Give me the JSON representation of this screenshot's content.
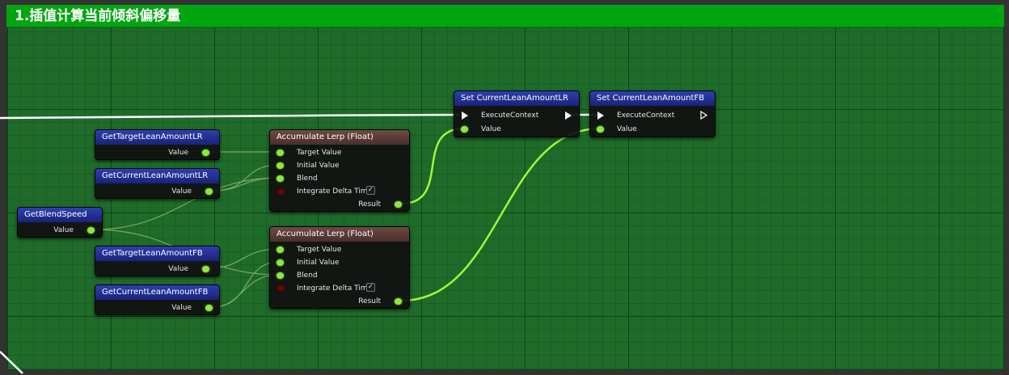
{
  "comment": {
    "title": "1.插值计算当前倾斜偏移量",
    "color": "#00a510"
  },
  "nodes": {
    "get_target_lr": {
      "title": "GetTargetLeanAmountLR",
      "out_label": "Value"
    },
    "get_current_lr": {
      "title": "GetCurrentLeanAmountLR",
      "out_label": "Value"
    },
    "get_blend_speed": {
      "title": "GetBlendSpeed",
      "out_label": "Value"
    },
    "get_target_fb": {
      "title": "GetTargetLeanAmountFB",
      "out_label": "Value"
    },
    "get_current_fb": {
      "title": "GetCurrentLeanAmountFB",
      "out_label": "Value"
    },
    "lerp_lr": {
      "title": "Accumulate Lerp (Float)",
      "inputs": [
        "Target Value",
        "Initial Value",
        "Blend",
        "Integrate Delta Time"
      ],
      "output": "Result",
      "integrate_checked": true
    },
    "lerp_fb": {
      "title": "Accumulate Lerp (Float)",
      "inputs": [
        "Target Value",
        "Initial Value",
        "Blend",
        "Integrate Delta Time"
      ],
      "output": "Result",
      "integrate_checked": true
    },
    "set_lr": {
      "title": "Set CurrentLeanAmountLR",
      "exec_label": "ExecuteContext",
      "value_label": "Value"
    },
    "set_fb": {
      "title": "Set CurrentLeanAmountFB",
      "exec_label": "ExecuteContext",
      "value_label": "Value"
    }
  },
  "colors": {
    "float_pin": "#8bea3e",
    "bool_pin": "#7a0000",
    "exec_pin": "#ffffff",
    "get_node_header": "#2d3fae",
    "function_node_header": "#6e4a44"
  }
}
